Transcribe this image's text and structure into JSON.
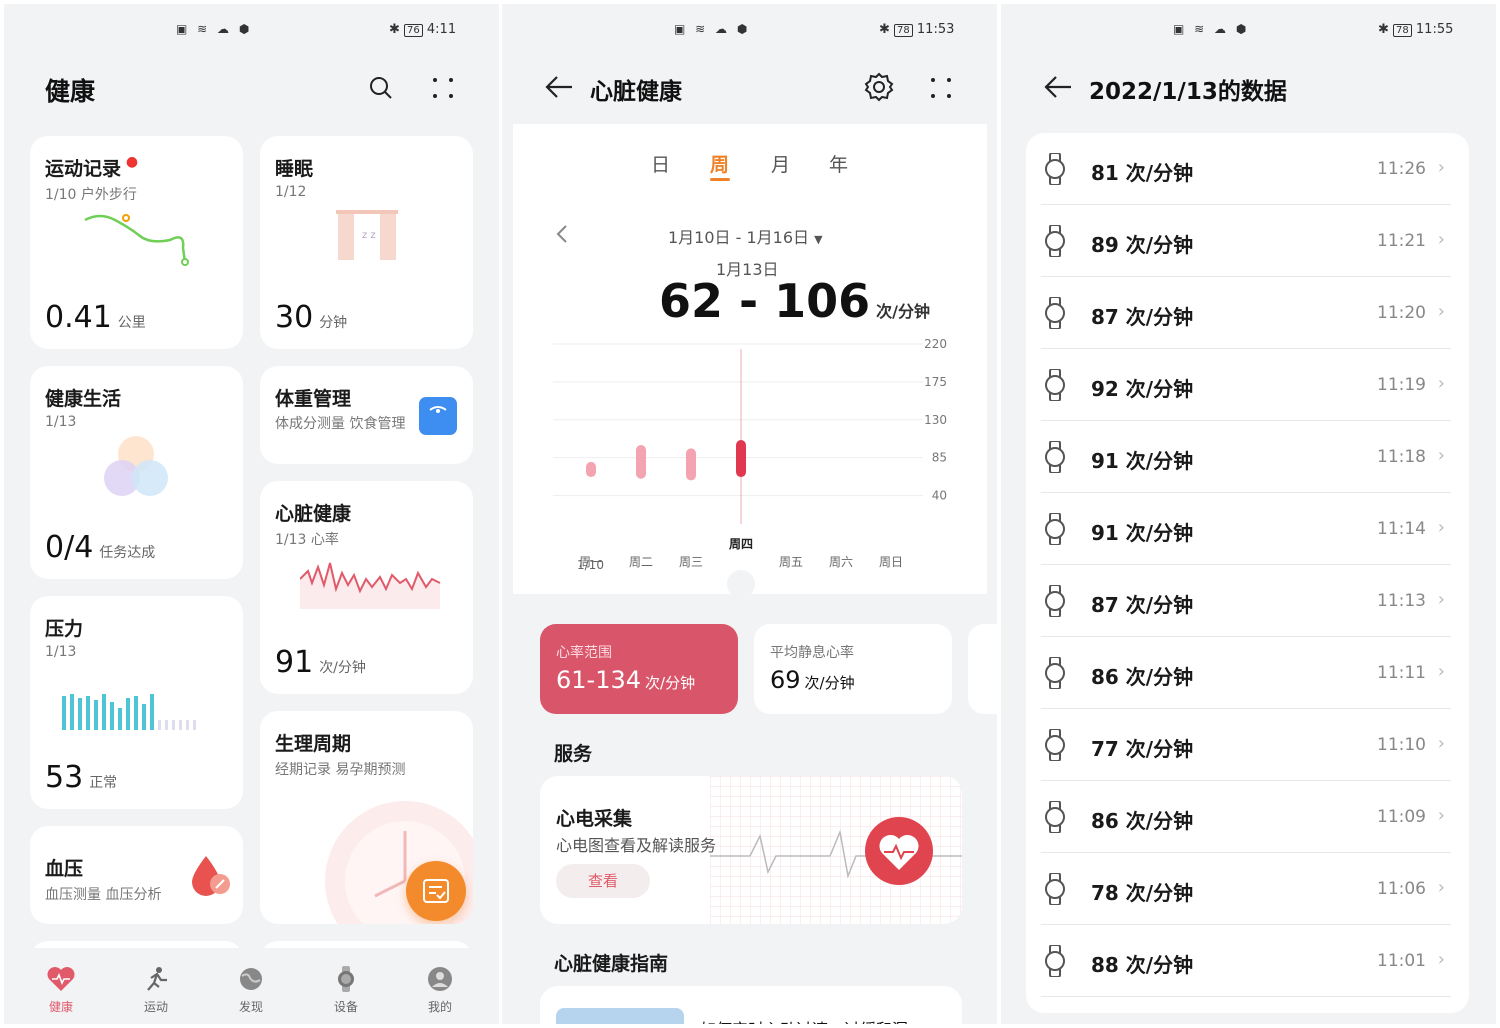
{
  "panel1": {
    "status": {
      "left": "▣ ≋ ☁ ⬢",
      "battery": "76",
      "time": "4:11"
    },
    "title": "健康",
    "cards": {
      "exercise": {
        "title": "运动记录",
        "sub": "1/10 户外步行",
        "value": "0.41",
        "unit": "公里"
      },
      "sleep": {
        "title": "睡眠",
        "sub": "1/12",
        "value": "30",
        "unit": "分钟"
      },
      "life": {
        "title": "健康生活",
        "sub": "1/13",
        "value": "0/4",
        "unit": "任务达成"
      },
      "weight": {
        "title": "体重管理",
        "sub": "体成分测量 饮食管理"
      },
      "heart": {
        "title": "心脏健康",
        "sub": "1/13 心率",
        "value": "91",
        "unit": "次/分钟"
      },
      "stress": {
        "title": "压力",
        "sub": "1/13",
        "value": "53",
        "unit": "正常"
      },
      "period": {
        "title": "生理周期",
        "sub": "经期记录 易孕期预测"
      },
      "bp": {
        "title": "血压",
        "sub": "血压测量 血压分析"
      }
    },
    "nav": [
      {
        "label": "健康",
        "active": true
      },
      {
        "label": "运动"
      },
      {
        "label": "发现"
      },
      {
        "label": "设备"
      },
      {
        "label": "我的"
      }
    ]
  },
  "panel2": {
    "status": {
      "battery": "78",
      "time": "11:53"
    },
    "title": "心脏健康",
    "tabs": [
      "日",
      "周",
      "月",
      "年"
    ],
    "active_tab": "周",
    "range": "1月10日 - 1月16日",
    "date": "1月13日",
    "hr_range": "62 - 106",
    "hr_unit": "次/分钟",
    "date_first": "1/10",
    "chart_data": {
      "type": "bar",
      "categories": [
        "周一",
        "周二",
        "周三",
        "周四",
        "周五",
        "周六",
        "周日"
      ],
      "series": [
        {
          "low": [
            62,
            null,
            null,
            62,
            null,
            null,
            null
          ],
          "high": [
            80,
            null,
            null,
            106,
            null,
            null,
            null
          ]
        }
      ],
      "lows": [
        62,
        60,
        58,
        62,
        null,
        null,
        null
      ],
      "highs": [
        80,
        100,
        96,
        106,
        null,
        null,
        null
      ],
      "yticks": [
        220,
        175,
        130,
        85,
        40
      ],
      "ylim": [
        30,
        220
      ],
      "selected": "周四"
    },
    "stat1": {
      "label": "心率范围",
      "value": "61-134",
      "unit": "次/分钟"
    },
    "stat2": {
      "label": "平均静息心率",
      "value": "69",
      "unit": "次/分钟"
    },
    "services": "服务",
    "ecg": {
      "title": "心电采集",
      "sub": "心电图查看及解读服务",
      "button": "查看"
    },
    "guide": "心脏健康指南",
    "guide_text": "如何实时心动过速、过缓和漏"
  },
  "panel3": {
    "status": {
      "battery": "78",
      "time": "11:55"
    },
    "title": "2022/1/13的数据",
    "rows": [
      {
        "v": "81 次/分钟",
        "t": "11:26"
      },
      {
        "v": "89 次/分钟",
        "t": "11:21"
      },
      {
        "v": "87 次/分钟",
        "t": "11:20"
      },
      {
        "v": "92 次/分钟",
        "t": "11:19"
      },
      {
        "v": "91 次/分钟",
        "t": "11:18"
      },
      {
        "v": "91 次/分钟",
        "t": "11:14"
      },
      {
        "v": "87 次/分钟",
        "t": "11:13"
      },
      {
        "v": "86 次/分钟",
        "t": "11:11"
      },
      {
        "v": "77 次/分钟",
        "t": "11:10"
      },
      {
        "v": "86 次/分钟",
        "t": "11:09"
      },
      {
        "v": "78 次/分钟",
        "t": "11:06"
      },
      {
        "v": "88 次/分钟",
        "t": "11:01"
      }
    ]
  },
  "colors": {
    "accent": "#e15a6a",
    "orange": "#f0832a",
    "green": "#5cbf4b"
  }
}
